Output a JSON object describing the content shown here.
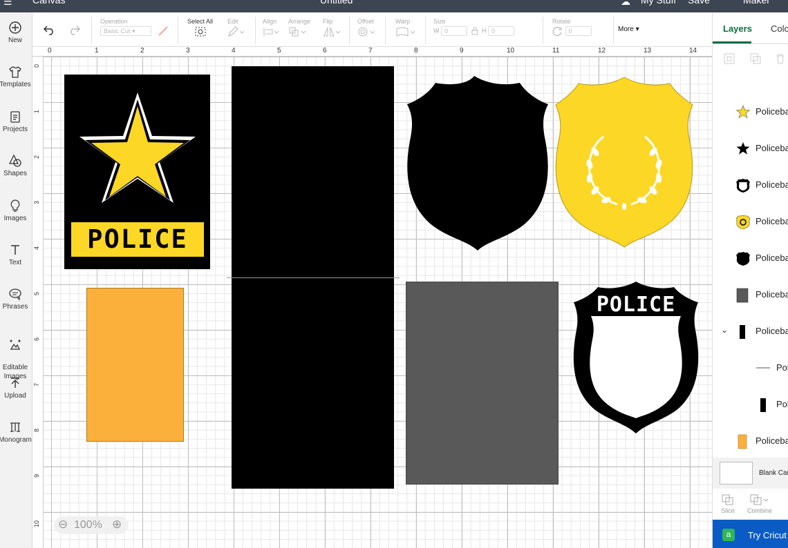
{
  "header": {
    "left_title": "Canvas",
    "center_title": "Untitled",
    "my_stuff": "My Stuff",
    "save": "Save",
    "machine": "Maker"
  },
  "sidebar": {
    "items": [
      {
        "label": "New",
        "icon": "plus-circle-icon"
      },
      {
        "label": "Templates",
        "icon": "shirt-icon"
      },
      {
        "label": "Projects",
        "icon": "projects-icon"
      },
      {
        "label": "Shapes",
        "icon": "shapes-icon"
      },
      {
        "label": "Images",
        "icon": "lightbulb-icon"
      },
      {
        "label": "Text",
        "icon": "text-icon"
      },
      {
        "label": "Phrases",
        "icon": "speech-bubble-icon"
      },
      {
        "label": "Editable\nImages",
        "icon": "editable-images-icon"
      },
      {
        "label": "Upload",
        "icon": "upload-icon"
      },
      {
        "label": "Monogram",
        "icon": "monogram-icon"
      }
    ]
  },
  "toolbar": {
    "operation_label": "Operation",
    "operation_value": "Basic Cut",
    "select_all": "Select All",
    "edit": "Edit",
    "align": "Align",
    "arrange": "Arrange",
    "flip": "Flip",
    "offset": "Offset",
    "warp": "Warp",
    "size": "Size",
    "size_w": "W",
    "size_w_value": "0",
    "size_h": "H",
    "size_h_value": "0",
    "rotate": "Rotate",
    "rotate_value": "0",
    "more": "More"
  },
  "ruler": {
    "top": [
      "0",
      "1",
      "2",
      "3",
      "4",
      "5",
      "6",
      "7",
      "8",
      "9",
      "10",
      "11",
      "12",
      "13",
      "14"
    ],
    "left": [
      "0",
      "1",
      "2",
      "3",
      "4",
      "5",
      "6",
      "7",
      "8",
      "9",
      "10"
    ]
  },
  "canvas": {
    "card_text": "POLICE",
    "badge_text": "POLICE",
    "zoom": "100%",
    "colors": {
      "black": "#000000",
      "yellow": "#fcd725",
      "orange": "#fbb03b",
      "gray": "#595959",
      "grid": "#bfbfbf"
    }
  },
  "right_panel": {
    "tabs": [
      "Layers",
      "Color"
    ],
    "layers": [
      {
        "name": "Policeba",
        "icon": "yellow-star-icon"
      },
      {
        "name": "Policeba",
        "icon": "black-star-icon"
      },
      {
        "name": "Policeba",
        "icon": "badge-outline-icon"
      },
      {
        "name": "Policeba",
        "icon": "gold-badge-icon"
      },
      {
        "name": "Policeba",
        "icon": "black-badge-icon"
      },
      {
        "name": "Policeba",
        "icon": "gray-rect-icon"
      },
      {
        "name": "Policeba",
        "icon": "black-rect-icon"
      },
      {
        "name": "Pol",
        "icon": "line-icon"
      },
      {
        "name": "Pol",
        "icon": "black-rect-icon"
      },
      {
        "name": "Policeba",
        "icon": "orange-rect-icon"
      }
    ],
    "blank_canvas": "Blank Can",
    "slice": "Slice",
    "combine": "Combine",
    "try_btn": "Try Cricut"
  }
}
